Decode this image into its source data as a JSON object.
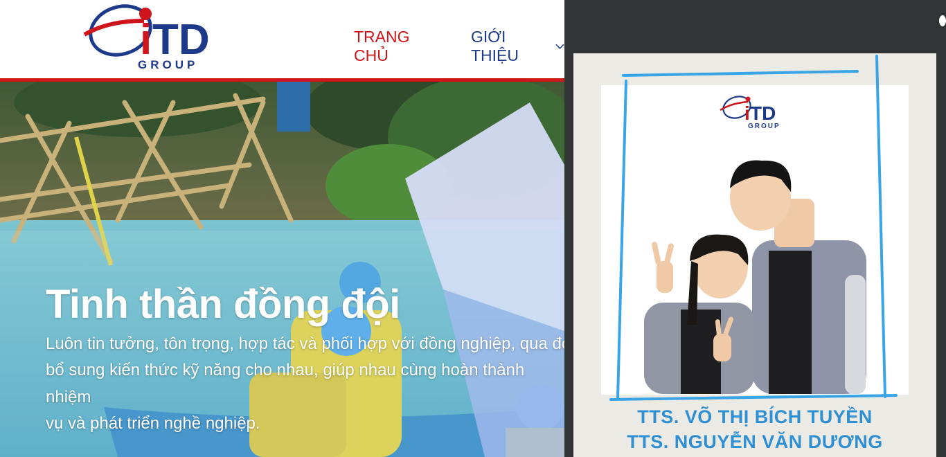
{
  "header": {
    "logo_text": "GROUP",
    "nav": {
      "home": "TRANG CHỦ",
      "about": "GIỚI THIỆU"
    }
  },
  "hero": {
    "title": "Tinh thần đồng đội",
    "description": "Luôn tin tưởng, tôn trọng, hợp tác và phối hợp với đồng nghiệp, qua đó\nbổ sung kiến thức kỹ năng cho nhau, giúp nhau cùng hoàn thành nhiệm\nvụ và phát triển nghề nghiệp."
  },
  "poster": {
    "logo_text": "GROUP",
    "name_1": "TTS. VÕ THỊ BÍCH TUYỀN",
    "name_2": "TTS. NGUYỄN VĂN DƯƠNG"
  },
  "colors": {
    "brand_red": "#d0141b",
    "brand_blue": "#1d3a8a",
    "poster_blue": "#2f8fd3",
    "panel_dark": "#323335"
  }
}
